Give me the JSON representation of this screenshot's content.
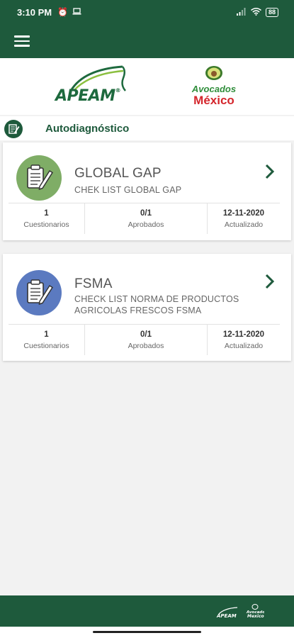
{
  "status_bar": {
    "time": "3:10 PM",
    "icons": [
      "alarm-icon",
      "laptop-icon",
      "signal-icon",
      "wifi-icon"
    ],
    "battery": "88"
  },
  "app_bar": {
    "menu_icon": "hamburger-menu-icon"
  },
  "logos": {
    "apeam": "APEAM",
    "avocados_line1": "Avocados",
    "avocados_line2": "México"
  },
  "section": {
    "icon": "edit-document-icon",
    "title": "Autodiagnóstico"
  },
  "cards": [
    {
      "icon": "checklist-edit-icon",
      "icon_color": "#7fad66",
      "title": "GLOBAL GAP",
      "subtitle": "CHEK LIST GLOBAL GAP",
      "stats": [
        {
          "value": "1",
          "label": "Cuestionarios"
        },
        {
          "value": "0/1",
          "label": "Aprobados"
        },
        {
          "value": "12-11-2020",
          "label": "Actualizado"
        }
      ]
    },
    {
      "icon": "checklist-edit-icon",
      "icon_color": "#5b7ac0",
      "title": "FSMA",
      "subtitle": "CHECK LIST NORMA DE PRODUCTOS AGRICOLAS FRESCOS FSMA",
      "stats": [
        {
          "value": "1",
          "label": "Cuestionarios"
        },
        {
          "value": "0/1",
          "label": "Aprobados"
        },
        {
          "value": "12-11-2020",
          "label": "Actualizado"
        }
      ]
    }
  ],
  "colors": {
    "primary": "#1e5a3c",
    "background": "#f2f2f2",
    "card": "#ffffff"
  }
}
